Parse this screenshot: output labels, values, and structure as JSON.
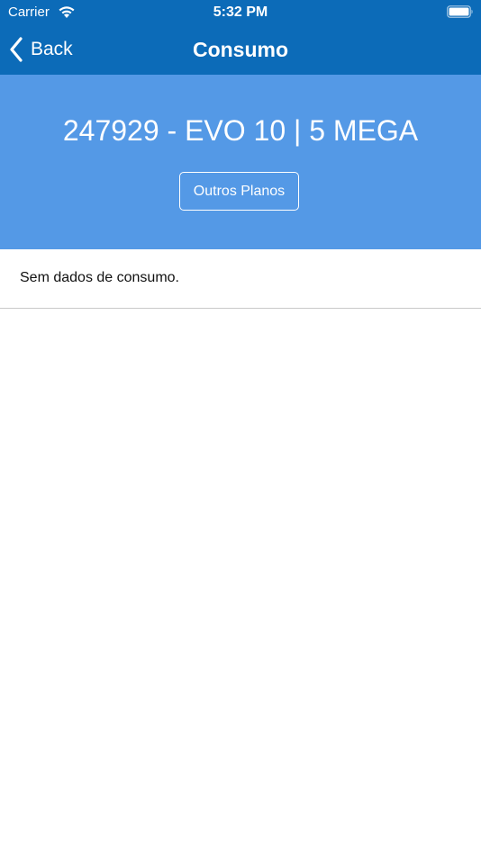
{
  "status_bar": {
    "carrier": "Carrier",
    "time": "5:32 PM",
    "wifi_icon": "wifi-icon",
    "battery_icon": "battery-icon"
  },
  "nav_bar": {
    "back_label": "Back",
    "title": "Consumo",
    "back_icon": "chevron-left-icon"
  },
  "plan_header": {
    "plan_name": "247929 - EVO 10 | 5 MEGA",
    "other_plans_label": "Outros Planos"
  },
  "usage": {
    "empty_message": "Sem dados de consumo."
  },
  "colors": {
    "nav_background": "#0c6bb8",
    "header_background": "#5499e6",
    "text_on_dark": "#ffffff",
    "divider": "#c8c8c8"
  }
}
